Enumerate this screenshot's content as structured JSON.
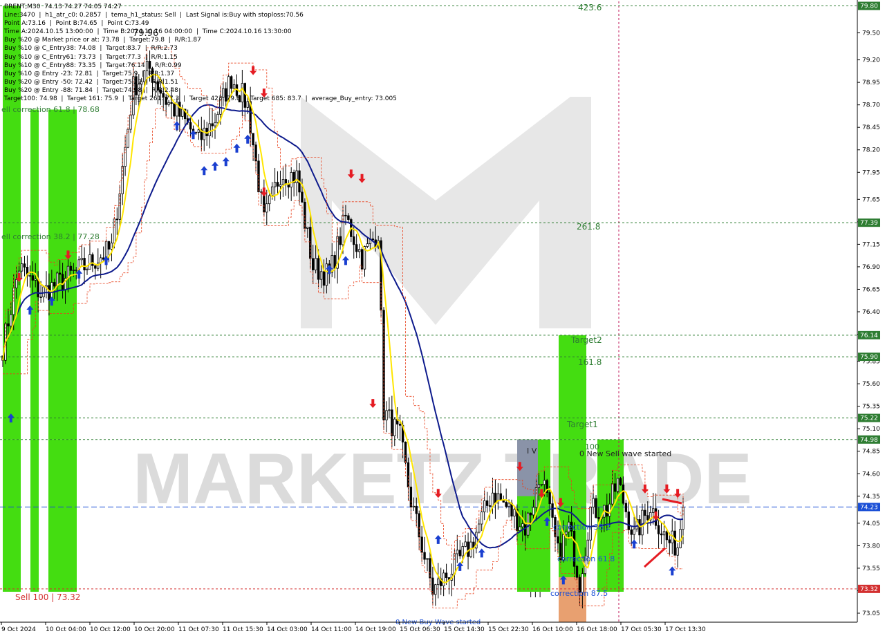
{
  "header_lines": [
    "BRENT,M30  74.13 74.27 74.05 74.27",
    "Line:3470  |  h1_atr_c0: 0.2857  |  tema_h1_status: Sell  |  Last Signal is:Buy with stoploss:70.56",
    "Point A:73.16  |  Point B:74.65  |  Point C:73.49",
    "Time A:2024.10.15 13:00:00  |  Time B:2024.10.16 04:00:00  |  Time C:2024.10.16 13:30:00",
    "Buy %20 @ Market price or at: 73.78  |  Target:79.8  |  R/R:1.87",
    "Buy %10 @ C_Entry38: 74.08  |  Target:83.7  |  R/R:2.73",
    "Buy %10 @ C_Entry61: 73.73  |  Target:77.3  |  R/R:1.15",
    "Buy %10 @ C_Entry88: 73.35  |  Target:76.14  |  R/R:0.99",
    "Buy %10 @ Entry -23: 72.81  |  Target:75.9  |  R/R:1.37",
    "Buy %20 @ Entry -50: 72.42  |  Target:75.22  |  R/R:1.51",
    "Buy %20 @ Entry -88: 71.84  |  Target:74.98  |  R/R:2.48",
    "Target100: 74.98  |  Target 161: 75.9  |  Target 261: 77.3  |  Target 423: 79.8  |  Target 685: 83.7  |  average_Buy_entry: 73.005"
  ],
  "watermark": "MARKETZ TRADE",
  "chart_data": {
    "type": "candlestick",
    "symbol": "BRENT",
    "timeframe": "M30",
    "ylim": [
      72.95,
      79.85
    ],
    "y_ticks": [
      79.5,
      79.2,
      78.95,
      78.7,
      78.45,
      78.2,
      77.95,
      77.65,
      77.4,
      77.15,
      76.9,
      76.65,
      76.4,
      76.15,
      75.85,
      75.6,
      75.35,
      75.1,
      74.85,
      74.6,
      74.35,
      74.05,
      73.8,
      73.55,
      73.3,
      73.05
    ],
    "y_tick_labels": [
      "79.50",
      "79.20",
      "78.95",
      "78.70",
      "78.45",
      "78.20",
      "77.95",
      "77.65",
      "77.40",
      "77.15",
      "76.90",
      "76.65",
      "76.40",
      "76.15",
      "75.85",
      "75.60",
      "75.35",
      "75.10",
      "74.85",
      "74.60",
      "74.35",
      "74.05",
      "73.80",
      "73.55",
      "73.30",
      "73.05"
    ],
    "x_labels": [
      "9 Oct 2024",
      "10 Oct 04:00",
      "10 Oct 12:00",
      "10 Oct 20:00",
      "11 Oct 07:30",
      "11 Oct 15:30",
      "14 Oct 03:00",
      "14 Oct 11:00",
      "14 Oct 19:00",
      "15 Oct 06:30",
      "15 Oct 14:30",
      "15 Oct 22:30",
      "16 Oct 10:00",
      "16 Oct 18:00",
      "17 Oct 05:30",
      "17 Oct 13:30"
    ],
    "current_price": 74.23,
    "price_tags": [
      {
        "value": 79.8,
        "label": "79.80",
        "color": "#2e7d32"
      },
      {
        "value": 77.39,
        "label": "77.39",
        "color": "#2e7d32"
      },
      {
        "value": 76.14,
        "label": "76.14",
        "color": "#2e7d32"
      },
      {
        "value": 75.9,
        "label": "75.90",
        "color": "#2e7d32"
      },
      {
        "value": 75.22,
        "label": "75.22",
        "color": "#2e7d32"
      },
      {
        "value": 74.98,
        "label": "74.98",
        "color": "#2e7d32"
      },
      {
        "value": 74.23,
        "label": "74.23",
        "color": "#1a4fd6"
      },
      {
        "value": 73.32,
        "label": "73.32",
        "color": "#d32f2f"
      }
    ],
    "levels": [
      {
        "value": 79.8,
        "color": "#2e7d32"
      },
      {
        "value": 77.39,
        "color": "#2e7d32"
      },
      {
        "value": 76.14,
        "color": "#2e7d32"
      },
      {
        "value": 75.9,
        "color": "#2e7d32"
      },
      {
        "value": 75.22,
        "color": "#2e7d32"
      },
      {
        "value": 74.98,
        "color": "#2e7d32"
      },
      {
        "value": 73.32,
        "color": "#d32f2f"
      }
    ],
    "annotations": [
      {
        "text": "423.6",
        "color": "#2e7d32"
      },
      {
        "text": "261.8",
        "color": "#2e7d32"
      },
      {
        "text": "Target2",
        "color": "#2e7d32"
      },
      {
        "text": "161.8",
        "color": "#2e7d32"
      },
      {
        "text": "Target1",
        "color": "#2e7d32"
      },
      {
        "text": "100",
        "color": "#2e7d32"
      },
      {
        "text": "0 New Sell wave started",
        "color": "#222222"
      },
      {
        "text": "ell correction 61.8 | 78.68",
        "color": "#2e7d32"
      },
      {
        "text": "ell correction 38.2 | 77.28",
        "color": "#2e7d32"
      },
      {
        "text": "Sell 100 | 73.32",
        "color": "#d32f2f"
      },
      {
        "text": "I V",
        "color": "#222222"
      },
      {
        "text": "I I I",
        "color": "#222222"
      },
      {
        "text": "correction 38.2",
        "color": "#1a4fd6"
      },
      {
        "text": "correction 61.8",
        "color": "#1a4fd6"
      },
      {
        "text": "correction 87.5",
        "color": "#1a4fd6"
      },
      {
        "text": "0 New Buy Wave started",
        "color": "#1a4fd6"
      },
      {
        "text": "79.96",
        "color": "#222222"
      }
    ],
    "close_anchors": [
      [
        0,
        76.0
      ],
      [
        6,
        76.9
      ],
      [
        14,
        76.6
      ],
      [
        22,
        76.75
      ],
      [
        30,
        76.9
      ],
      [
        40,
        77.1
      ],
      [
        48,
        78.9
      ],
      [
        54,
        79.1
      ],
      [
        60,
        78.75
      ],
      [
        66,
        78.55
      ],
      [
        72,
        78.3
      ],
      [
        78,
        78.55
      ],
      [
        84,
        79.0
      ],
      [
        90,
        78.7
      ],
      [
        96,
        77.4
      ],
      [
        102,
        77.95
      ],
      [
        108,
        77.9
      ],
      [
        114,
        76.9
      ],
      [
        120,
        76.8
      ],
      [
        126,
        77.45
      ],
      [
        132,
        77.0
      ],
      [
        138,
        77.3
      ],
      [
        140,
        75.3
      ],
      [
        146,
        75.0
      ],
      [
        150,
        74.3
      ],
      [
        158,
        73.3
      ],
      [
        164,
        73.5
      ],
      [
        172,
        73.8
      ],
      [
        180,
        74.4
      ],
      [
        186,
        74.2
      ],
      [
        192,
        74.0
      ],
      [
        198,
        74.6
      ],
      [
        204,
        73.7
      ],
      [
        208,
        74.0
      ],
      [
        212,
        73.4
      ],
      [
        216,
        74.2
      ],
      [
        222,
        74.2
      ],
      [
        226,
        74.5
      ],
      [
        232,
        73.9
      ],
      [
        238,
        74.25
      ],
      [
        244,
        73.85
      ],
      [
        248,
        73.8
      ],
      [
        250,
        74.27
      ]
    ],
    "buy_signal_prices": [
      75.3,
      76.5,
      76.6,
      76.9,
      77.05,
      78.55,
      78.45,
      78.05,
      78.1,
      78.15,
      78.3,
      78.4,
      76.95,
      77.05,
      73.95,
      73.65,
      73.8,
      74.15,
      73.5,
      73.9,
      73.6
    ],
    "sell_signal_prices": [
      76.7,
      76.95,
      79.0,
      78.75,
      77.65,
      77.85,
      77.8,
      75.3,
      74.3,
      74.6,
      74.3,
      74.2,
      74.35,
      74.05,
      74.35,
      74.3
    ]
  }
}
